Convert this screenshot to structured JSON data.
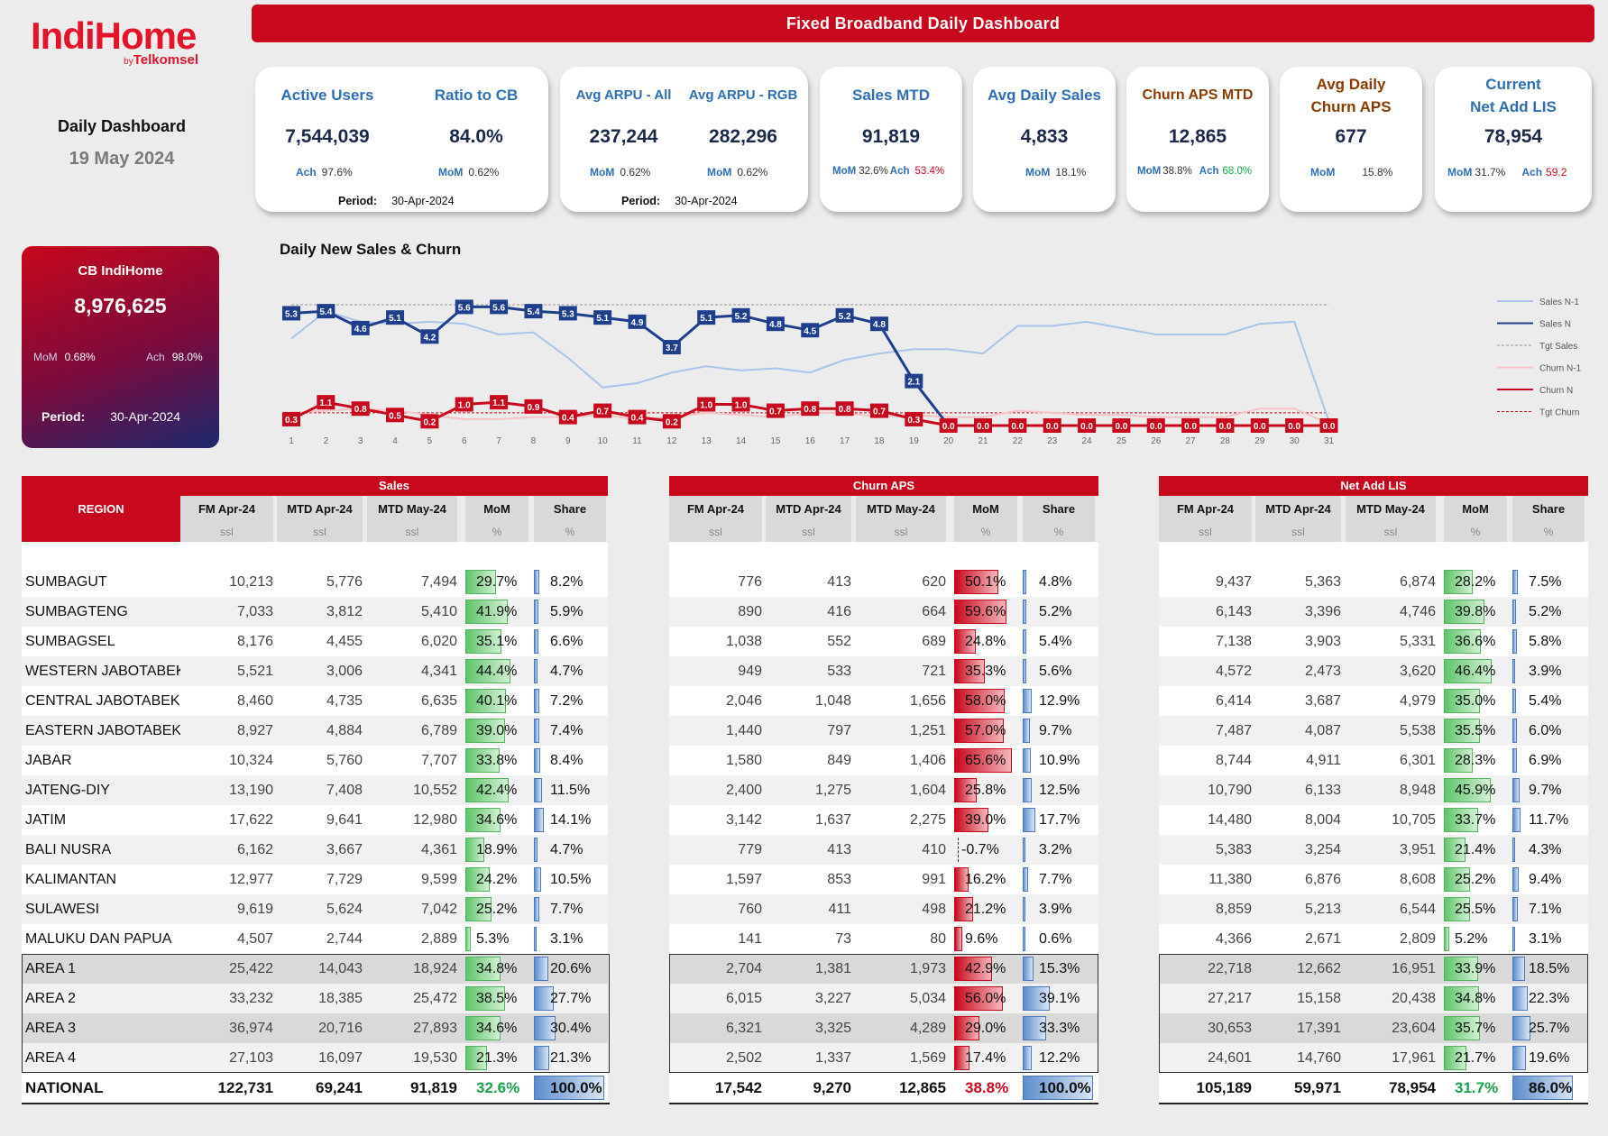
{
  "brand": {
    "logo_main": "IndiHome",
    "logo_by": "by",
    "logo_sub": "Telkomsel"
  },
  "header": {
    "dashboard_title": "Daily Dashboard",
    "date": "19 May 2024",
    "banner": "Fixed Broadband Daily Dashboard"
  },
  "kpi": {
    "active_users": {
      "title": "Active Users",
      "value": "7,544,039",
      "meta_label": "Ach",
      "meta_value": "97.6%"
    },
    "ratio_cb": {
      "title": "Ratio to CB",
      "value": "84.0%",
      "meta_label": "MoM",
      "meta_value": "0.62%"
    },
    "period1": {
      "label": "Period:",
      "value": "30-Apr-2024"
    },
    "arpu_all": {
      "title": "Avg ARPU - All",
      "value": "237,244",
      "meta_label": "MoM",
      "meta_value": "0.62%"
    },
    "arpu_rgb": {
      "title": "Avg ARPU - RGB",
      "value": "282,296",
      "meta_label": "MoM",
      "meta_value": "0.62%"
    },
    "period2": {
      "label": "Period:",
      "value": "30-Apr-2024"
    },
    "sales_mtd": {
      "title": "Sales MTD",
      "value": "91,819",
      "mom_label": "MoM",
      "mom_value": "32.6%",
      "ach_label": "Ach",
      "ach_value": "53.4%"
    },
    "avg_daily_sales": {
      "title": "Avg Daily Sales",
      "value": "4,833",
      "mom_label": "MoM",
      "mom_value": "18.1%"
    },
    "churn_aps_mtd": {
      "title": "Churn APS MTD",
      "value": "12,865",
      "mom_label": "MoM",
      "mom_value": "38.8%",
      "ach_label": "Ach",
      "ach_value": "68.0%"
    },
    "avg_daily_churn": {
      "title1": "Avg Daily",
      "title2": "Churn APS",
      "value": "677",
      "mom_label": "MoM",
      "mom_value": "15.8%"
    },
    "net_add": {
      "title1": "Current",
      "title2": "Net Add LIS",
      "value": "78,954",
      "mom_label": "MoM",
      "mom_value": "31.7%",
      "ach_label": "Ach",
      "ach_value": "59.2"
    }
  },
  "cb": {
    "title": "CB IndiHome",
    "value": "8,976,625",
    "mom_label": "MoM",
    "mom_value": "0.68%",
    "ach_label": "Ach",
    "ach_value": "98.0%",
    "period_label": "Period:",
    "period_value": "30-Apr-2024"
  },
  "chart_data": {
    "type": "line",
    "title": "Daily New Sales & Churn",
    "x": [
      1,
      2,
      3,
      4,
      5,
      6,
      7,
      8,
      9,
      10,
      11,
      12,
      13,
      14,
      15,
      16,
      17,
      18,
      19,
      20,
      21,
      22,
      23,
      24,
      25,
      26,
      27,
      28,
      29,
      30,
      31
    ],
    "series": [
      {
        "name": "Sales N-1",
        "color": "#a9c4ea",
        "values": [
          4.1,
          5.4,
          4.9,
          4.8,
          4.9,
          4.8,
          4.3,
          4.4,
          3.2,
          1.8,
          2.0,
          2.5,
          2.8,
          2.6,
          2.7,
          2.5,
          3.1,
          3.4,
          3.6,
          3.6,
          3.4,
          4.7,
          4.7,
          4.9,
          4.6,
          4.3,
          4.3,
          4.3,
          4.8,
          4.9,
          0.2
        ]
      },
      {
        "name": "Sales N",
        "color": "#1f3f8c",
        "values": [
          5.3,
          5.4,
          4.6,
          5.1,
          4.2,
          5.6,
          5.6,
          5.4,
          5.3,
          5.1,
          4.9,
          3.7,
          5.1,
          5.2,
          4.8,
          4.5,
          5.2,
          4.8,
          2.1,
          0.0
        ]
      },
      {
        "name": "Tgt Sales",
        "color": "#999999",
        "values": [
          5.7,
          5.7,
          5.7,
          5.7,
          5.7,
          5.7,
          5.7,
          5.7,
          5.7,
          5.7,
          5.7,
          5.7,
          5.7,
          5.7,
          5.7,
          5.7,
          5.7,
          5.7,
          5.7,
          5.7,
          5.7,
          5.7,
          5.7,
          5.7,
          5.7,
          5.7,
          5.7,
          5.7,
          5.7,
          5.7,
          5.7
        ]
      },
      {
        "name": "Churn N-1",
        "color": "#f7c3c6",
        "values": [
          0.6,
          0.7,
          0.8,
          0.7,
          0.5,
          0.3,
          0.3,
          0.4,
          0.4,
          0.5,
          0.3,
          0.4,
          0.6,
          0.5,
          0.4,
          0.6,
          0.6,
          0.4,
          0.5,
          0.4,
          0.4,
          0.7,
          0.6,
          0.5,
          0.5,
          0.4,
          0.4,
          0.4,
          0.8,
          0.8,
          0.1
        ]
      },
      {
        "name": "Churn N",
        "color": "#c8081c",
        "values": [
          0.3,
          1.1,
          0.8,
          0.5,
          0.2,
          1.0,
          1.1,
          0.9,
          0.4,
          0.7,
          0.4,
          0.2,
          1.0,
          1.0,
          0.7,
          0.8,
          0.8,
          0.7,
          0.3,
          0.0,
          0.0,
          0.0,
          0.0,
          0.0,
          0.0,
          0.0,
          0.0,
          0.0,
          0.0,
          0.0,
          0.0
        ]
      },
      {
        "name": "Tgt Churn",
        "color": "#c8081c",
        "values": [
          0.6,
          0.6,
          0.6,
          0.6,
          0.6,
          0.6,
          0.6,
          0.6,
          0.6,
          0.6,
          0.6,
          0.6,
          0.6,
          0.6,
          0.6,
          0.6,
          0.6,
          0.6,
          0.6,
          0.6,
          0.6,
          0.6,
          0.6,
          0.6,
          0.6,
          0.6,
          0.6,
          0.6,
          0.6,
          0.6,
          0.6
        ]
      }
    ],
    "sales_labels": [
      "5.3",
      "5.4",
      "4.6",
      "5.1",
      "4.2",
      "5.6",
      "5.6",
      "5.4",
      "5.3",
      "5.1",
      "4.9",
      "3.7",
      "5.1",
      "5.2",
      "4.8",
      "4.5",
      "5.2",
      "4.8",
      "2.1"
    ],
    "churn_labels": [
      "0.3",
      "1.1",
      "0.8",
      "0.5",
      "0.2",
      "1.0",
      "1.1",
      "0.9",
      "0.4",
      "0.7",
      "0.4",
      "0.2",
      "1.0",
      "1.0",
      "0.7",
      "0.8",
      "0.8",
      "0.7",
      "0.3",
      "0.0",
      "0.0",
      "0.0",
      "0.0",
      "0.0",
      "0.0",
      "0.0",
      "0.0",
      "0.0",
      "0.0",
      "0.0",
      "0.0"
    ],
    "legend_position": "right"
  },
  "tables": {
    "region_header": "REGION",
    "groups": [
      {
        "title": "Sales",
        "cols": [
          "FM Apr-24",
          "MTD Apr-24",
          "MTD May-24",
          "MoM",
          "Share"
        ],
        "units": [
          "ssl",
          "ssl",
          "ssl",
          "%",
          "%"
        ]
      },
      {
        "title": "Churn APS",
        "cols": [
          "FM Apr-24",
          "MTD Apr-24",
          "MTD May-24",
          "MoM",
          "Share"
        ],
        "units": [
          "ssl",
          "ssl",
          "ssl",
          "%",
          "%"
        ]
      },
      {
        "title": "Net Add LIS",
        "cols": [
          "FM Apr-24",
          "MTD Apr-24",
          "MTD May-24",
          "MoM",
          "Share"
        ],
        "units": [
          "ssl",
          "ssl",
          "ssl",
          "%",
          "%"
        ]
      }
    ],
    "rows": [
      {
        "region": "SUMBAGUT",
        "sales": [
          "10,213",
          "5,776",
          "7,494",
          "29.7%",
          "8.2%"
        ],
        "churn": [
          "776",
          "413",
          "620",
          "50.1%",
          "4.8%"
        ],
        "net": [
          "9,437",
          "5,363",
          "6,874",
          "28.2%",
          "7.5%"
        ],
        "sm": 29.7,
        "ss": 8.2,
        "cm": 50.1,
        "cs": 4.8,
        "nm": 28.2,
        "ns": 7.5
      },
      {
        "region": "SUMBAGTENG",
        "sales": [
          "7,033",
          "3,812",
          "5,410",
          "41.9%",
          "5.9%"
        ],
        "churn": [
          "890",
          "416",
          "664",
          "59.6%",
          "5.2%"
        ],
        "net": [
          "6,143",
          "3,396",
          "4,746",
          "39.8%",
          "5.2%"
        ],
        "sm": 41.9,
        "ss": 5.9,
        "cm": 59.6,
        "cs": 5.2,
        "nm": 39.8,
        "ns": 5.2
      },
      {
        "region": "SUMBAGSEL",
        "sales": [
          "8,176",
          "4,455",
          "6,020",
          "35.1%",
          "6.6%"
        ],
        "churn": [
          "1,038",
          "552",
          "689",
          "24.8%",
          "5.4%"
        ],
        "net": [
          "7,138",
          "3,903",
          "5,331",
          "36.6%",
          "5.8%"
        ],
        "sm": 35.1,
        "ss": 6.6,
        "cm": 24.8,
        "cs": 5.4,
        "nm": 36.6,
        "ns": 5.8
      },
      {
        "region": "WESTERN JABOTABEK",
        "sales": [
          "5,521",
          "3,006",
          "4,341",
          "44.4%",
          "4.7%"
        ],
        "churn": [
          "949",
          "533",
          "721",
          "35.3%",
          "5.6%"
        ],
        "net": [
          "4,572",
          "2,473",
          "3,620",
          "46.4%",
          "3.9%"
        ],
        "sm": 44.4,
        "ss": 4.7,
        "cm": 35.3,
        "cs": 5.6,
        "nm": 46.4,
        "ns": 3.9
      },
      {
        "region": "CENTRAL JABOTABEK",
        "sales": [
          "8,460",
          "4,735",
          "6,635",
          "40.1%",
          "7.2%"
        ],
        "churn": [
          "2,046",
          "1,048",
          "1,656",
          "58.0%",
          "12.9%"
        ],
        "net": [
          "6,414",
          "3,687",
          "4,979",
          "35.0%",
          "5.4%"
        ],
        "sm": 40.1,
        "ss": 7.2,
        "cm": 58.0,
        "cs": 12.9,
        "nm": 35.0,
        "ns": 5.4
      },
      {
        "region": "EASTERN JABOTABEK",
        "sales": [
          "8,927",
          "4,884",
          "6,789",
          "39.0%",
          "7.4%"
        ],
        "churn": [
          "1,440",
          "797",
          "1,251",
          "57.0%",
          "9.7%"
        ],
        "net": [
          "7,487",
          "4,087",
          "5,538",
          "35.5%",
          "6.0%"
        ],
        "sm": 39.0,
        "ss": 7.4,
        "cm": 57.0,
        "cs": 9.7,
        "nm": 35.5,
        "ns": 6.0
      },
      {
        "region": "JABAR",
        "sales": [
          "10,324",
          "5,760",
          "7,707",
          "33.8%",
          "8.4%"
        ],
        "churn": [
          "1,580",
          "849",
          "1,406",
          "65.6%",
          "10.9%"
        ],
        "net": [
          "8,744",
          "4,911",
          "6,301",
          "28.3%",
          "6.9%"
        ],
        "sm": 33.8,
        "ss": 8.4,
        "cm": 65.6,
        "cs": 10.9,
        "nm": 28.3,
        "ns": 6.9
      },
      {
        "region": "JATENG-DIY",
        "sales": [
          "13,190",
          "7,408",
          "10,552",
          "42.4%",
          "11.5%"
        ],
        "churn": [
          "2,400",
          "1,275",
          "1,604",
          "25.8%",
          "12.5%"
        ],
        "net": [
          "10,790",
          "6,133",
          "8,948",
          "45.9%",
          "9.7%"
        ],
        "sm": 42.4,
        "ss": 11.5,
        "cm": 25.8,
        "cs": 12.5,
        "nm": 45.9,
        "ns": 9.7
      },
      {
        "region": "JATIM",
        "sales": [
          "17,622",
          "9,641",
          "12,980",
          "34.6%",
          "14.1%"
        ],
        "churn": [
          "3,142",
          "1,637",
          "2,275",
          "39.0%",
          "17.7%"
        ],
        "net": [
          "14,480",
          "8,004",
          "10,705",
          "33.7%",
          "11.7%"
        ],
        "sm": 34.6,
        "ss": 14.1,
        "cm": 39.0,
        "cs": 17.7,
        "nm": 33.7,
        "ns": 11.7
      },
      {
        "region": "BALI NUSRA",
        "sales": [
          "6,162",
          "3,667",
          "4,361",
          "18.9%",
          "4.7%"
        ],
        "churn": [
          "779",
          "413",
          "410",
          "-0.7%",
          "3.2%"
        ],
        "net": [
          "5,383",
          "3,254",
          "3,951",
          "21.4%",
          "4.3%"
        ],
        "sm": 18.9,
        "ss": 4.7,
        "cm": -0.7,
        "cs": 3.2,
        "nm": 21.4,
        "ns": 4.3
      },
      {
        "region": "KALIMANTAN",
        "sales": [
          "12,977",
          "7,729",
          "9,599",
          "24.2%",
          "10.5%"
        ],
        "churn": [
          "1,597",
          "853",
          "991",
          "16.2%",
          "7.7%"
        ],
        "net": [
          "11,380",
          "6,876",
          "8,608",
          "25.2%",
          "9.4%"
        ],
        "sm": 24.2,
        "ss": 10.5,
        "cm": 16.2,
        "cs": 7.7,
        "nm": 25.2,
        "ns": 9.4
      },
      {
        "region": "SULAWESI",
        "sales": [
          "9,619",
          "5,624",
          "7,042",
          "25.2%",
          "7.7%"
        ],
        "churn": [
          "760",
          "411",
          "498",
          "21.2%",
          "3.9%"
        ],
        "net": [
          "8,859",
          "5,213",
          "6,544",
          "25.5%",
          "7.1%"
        ],
        "sm": 25.2,
        "ss": 7.7,
        "cm": 21.2,
        "cs": 3.9,
        "nm": 25.5,
        "ns": 7.1
      },
      {
        "region": "MALUKU DAN PAPUA",
        "sales": [
          "4,507",
          "2,744",
          "2,889",
          "5.3%",
          "3.1%"
        ],
        "churn": [
          "141",
          "73",
          "80",
          "9.6%",
          "0.6%"
        ],
        "net": [
          "4,366",
          "2,671",
          "2,809",
          "5.2%",
          "3.1%"
        ],
        "sm": 5.3,
        "ss": 3.1,
        "cm": 9.6,
        "cs": 0.6,
        "nm": 5.2,
        "ns": 3.1
      }
    ],
    "area_rows": [
      {
        "region": "AREA 1",
        "sales": [
          "25,422",
          "14,043",
          "18,924",
          "34.8%",
          "20.6%"
        ],
        "churn": [
          "2,704",
          "1,381",
          "1,973",
          "42.9%",
          "15.3%"
        ],
        "net": [
          "22,718",
          "12,662",
          "16,951",
          "33.9%",
          "18.5%"
        ],
        "sm": 34.8,
        "ss": 20.6,
        "cm": 42.9,
        "cs": 15.3,
        "nm": 33.9,
        "ns": 18.5
      },
      {
        "region": "AREA 2",
        "sales": [
          "33,232",
          "18,385",
          "25,472",
          "38.5%",
          "27.7%"
        ],
        "churn": [
          "6,015",
          "3,227",
          "5,034",
          "56.0%",
          "39.1%"
        ],
        "net": [
          "27,217",
          "15,158",
          "20,438",
          "34.8%",
          "22.3%"
        ],
        "sm": 38.5,
        "ss": 27.7,
        "cm": 56.0,
        "cs": 39.1,
        "nm": 34.8,
        "ns": 22.3
      },
      {
        "region": "AREA 3",
        "sales": [
          "36,974",
          "20,716",
          "27,893",
          "34.6%",
          "30.4%"
        ],
        "churn": [
          "6,321",
          "3,325",
          "4,289",
          "29.0%",
          "33.3%"
        ],
        "net": [
          "30,653",
          "17,391",
          "23,604",
          "35.7%",
          "25.7%"
        ],
        "sm": 34.6,
        "ss": 30.4,
        "cm": 29.0,
        "cs": 33.3,
        "nm": 35.7,
        "ns": 25.7
      },
      {
        "region": "AREA 4",
        "sales": [
          "27,103",
          "16,097",
          "19,530",
          "21.3%",
          "21.3%"
        ],
        "churn": [
          "2,502",
          "1,337",
          "1,569",
          "17.4%",
          "12.2%"
        ],
        "net": [
          "24,601",
          "14,760",
          "17,961",
          "21.7%",
          "19.6%"
        ],
        "sm": 21.3,
        "ss": 21.3,
        "cm": 17.4,
        "cs": 12.2,
        "nm": 21.7,
        "ns": 19.6
      }
    ],
    "national": {
      "region": "NATIONAL",
      "sales": [
        "122,731",
        "69,241",
        "91,819",
        "32.6%",
        "100.0%"
      ],
      "churn": [
        "17,542",
        "9,270",
        "12,865",
        "38.8%",
        "100.0%"
      ],
      "net": [
        "105,189",
        "59,971",
        "78,954",
        "31.7%",
        "86.0%"
      ],
      "sm": 32.6,
      "ss": 100,
      "cm": 38.8,
      "cs": 100,
      "nm": 31.7,
      "ns": 86.0
    }
  }
}
